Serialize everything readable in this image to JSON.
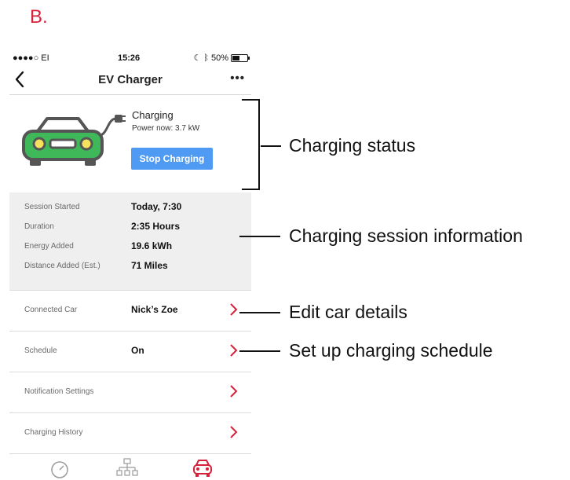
{
  "figure_label": "B.",
  "status_bar": {
    "signal": "●●●●○ EI",
    "time": "15:26",
    "battery_text": "50%"
  },
  "nav": {
    "back_icon": "chevron-left-icon",
    "title": "EV Charger",
    "more_icon": "more-dots-icon"
  },
  "charging": {
    "state": "Charging",
    "power": "Power now: 3.7 kW",
    "stop_label": "Stop Charging",
    "car_color": "#3fb85a",
    "button_color": "#4f9bf4"
  },
  "session": {
    "rows": [
      {
        "label": "Session Started",
        "value": "Today, 7:30"
      },
      {
        "label": "Duration",
        "value": "2:35 Hours"
      },
      {
        "label": "Energy Added",
        "value": "19.6 kWh"
      },
      {
        "label": "Distance Added  (Est.)",
        "value": "71 Miles"
      }
    ]
  },
  "settings": [
    {
      "label": "Connected Car",
      "value": "Nick’s Zoe"
    },
    {
      "label": "Schedule",
      "value": "On"
    },
    {
      "label": "Notification Settings",
      "value": ""
    },
    {
      "label": "Charging History",
      "value": ""
    }
  ],
  "tabs": [
    "gauge-icon",
    "network-icon",
    "car-icon"
  ],
  "annotations": {
    "charging_status": "Charging status",
    "session_info": "Charging session information",
    "edit_car": "Edit car details",
    "schedule": "Set up charging schedule"
  },
  "accent_color": "#d6213a"
}
